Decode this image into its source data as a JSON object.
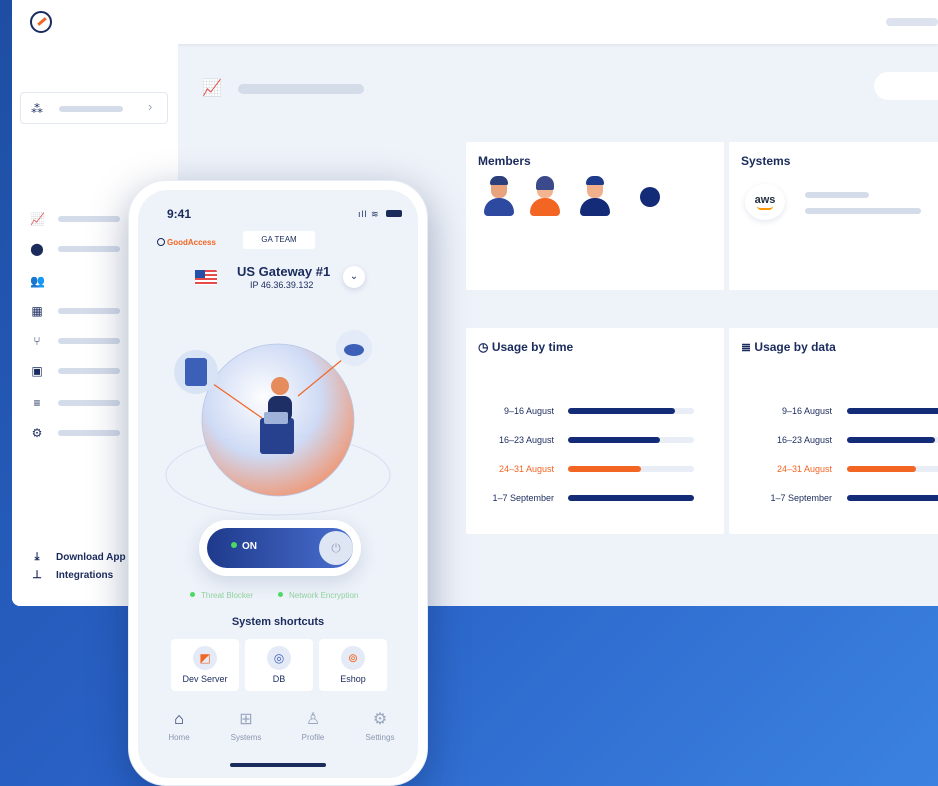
{
  "brand": {
    "accent": "#f26522",
    "primary": "#142b78"
  },
  "sidebar": {
    "org_selector_icon": "org-icon",
    "items": [
      {
        "icon": "chart-icon",
        "glyph": "📈"
      },
      {
        "icon": "location-icon",
        "glyph": "⬤"
      },
      {
        "icon": "users-icon",
        "glyph": "👥"
      },
      {
        "icon": "apps-grid-icon",
        "glyph": "▦"
      },
      {
        "icon": "branch-icon",
        "glyph": "⑂"
      },
      {
        "icon": "id-card-icon",
        "glyph": "▣"
      },
      {
        "icon": "list-icon",
        "glyph": "≡"
      },
      {
        "icon": "gears-icon",
        "glyph": "⚙"
      }
    ],
    "download_app": "Download App",
    "integrations": "Integrations"
  },
  "members_card": {
    "title": "Members"
  },
  "systems_card": {
    "title": "Systems",
    "logo_text": "aws"
  },
  "usage_by_time": {
    "title": "Usage by time",
    "rows": [
      {
        "label": "9–16 August",
        "value": 0.85
      },
      {
        "label": "16–23 August",
        "value": 0.73
      },
      {
        "label": "24–31 August",
        "value": 0.58,
        "highlight": true
      },
      {
        "label": "1–7 September",
        "value": 1.0
      }
    ]
  },
  "usage_by_data": {
    "title": "Usage by data",
    "rows": [
      {
        "label": "9–16 August",
        "value": 0.98
      },
      {
        "label": "16–23 August",
        "value": 0.8
      },
      {
        "label": "24–31 August",
        "value": 0.63,
        "highlight": true
      },
      {
        "label": "1–7 September",
        "value": 0.98
      }
    ]
  },
  "phone": {
    "time": "9:41",
    "brand_name": "GoodAccess",
    "team": "GA TEAM",
    "gateway_name": "US Gateway #1",
    "gateway_ip": "IP 46.36.39.132",
    "toggle_label": "ON",
    "features": [
      "Threat Blocker",
      "Network Encryption"
    ],
    "shortcuts_title": "System shortcuts",
    "shortcuts": [
      {
        "label": "Dev Server",
        "icon": "server-chart-icon"
      },
      {
        "label": "DB",
        "icon": "database-icon"
      },
      {
        "label": "Eshop",
        "icon": "lifebuoy-icon"
      }
    ],
    "tabs": [
      {
        "label": "Home",
        "icon": "home-icon"
      },
      {
        "label": "Systems",
        "icon": "grid-icon"
      },
      {
        "label": "Profile",
        "icon": "user-icon"
      },
      {
        "label": "Settings",
        "icon": "gear-icon"
      }
    ]
  }
}
